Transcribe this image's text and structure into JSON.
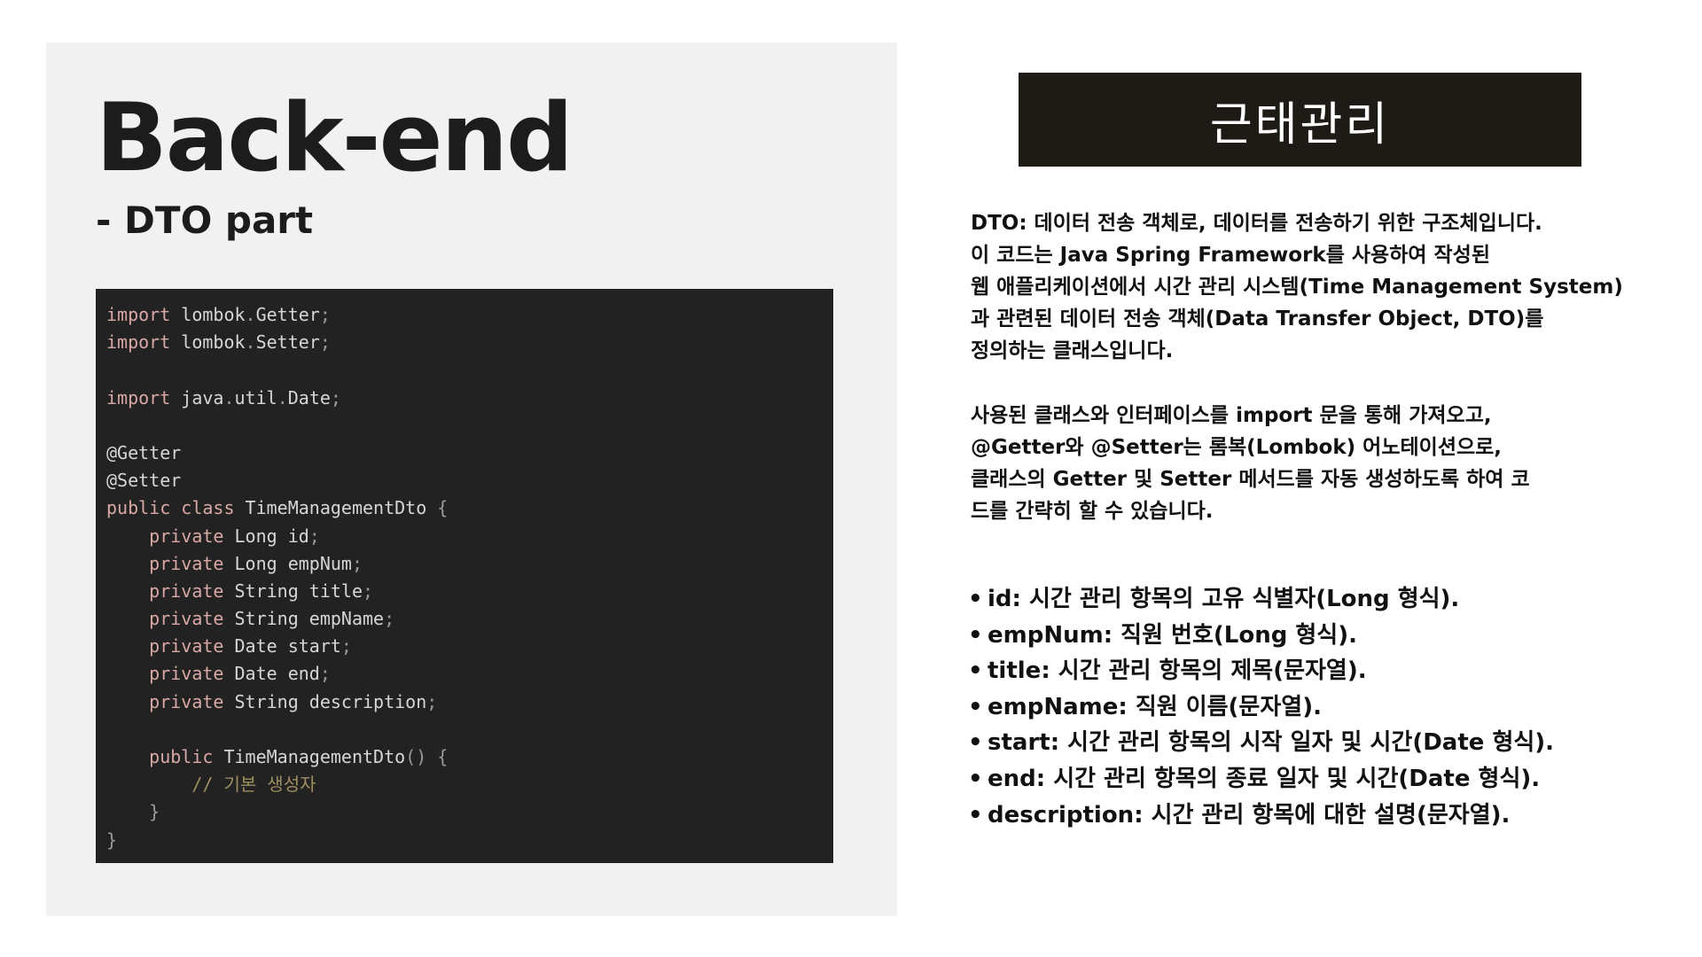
{
  "slide": {
    "title": "Back-end",
    "subtitle": "- DTO part",
    "header": "근태관리"
  },
  "code": {
    "lines": [
      [
        {
          "t": "kw",
          "v": "import"
        },
        {
          "t": "txt",
          "v": " lombok"
        },
        {
          "t": "punct",
          "v": "."
        },
        {
          "t": "txt",
          "v": "Getter"
        },
        {
          "t": "punct",
          "v": ";"
        }
      ],
      [
        {
          "t": "kw",
          "v": "import"
        },
        {
          "t": "txt",
          "v": " lombok"
        },
        {
          "t": "punct",
          "v": "."
        },
        {
          "t": "txt",
          "v": "Setter"
        },
        {
          "t": "punct",
          "v": ";"
        }
      ],
      [],
      [
        {
          "t": "kw",
          "v": "import"
        },
        {
          "t": "txt",
          "v": " java"
        },
        {
          "t": "punct",
          "v": "."
        },
        {
          "t": "txt",
          "v": "util"
        },
        {
          "t": "punct",
          "v": "."
        },
        {
          "t": "txt",
          "v": "Date"
        },
        {
          "t": "punct",
          "v": ";"
        }
      ],
      [],
      [
        {
          "t": "ann",
          "v": "@Getter"
        }
      ],
      [
        {
          "t": "ann",
          "v": "@Setter"
        }
      ],
      [
        {
          "t": "kw",
          "v": "public class"
        },
        {
          "t": "txt",
          "v": " TimeManagementDto "
        },
        {
          "t": "punct",
          "v": "{"
        }
      ],
      [
        {
          "t": "txt",
          "v": "    "
        },
        {
          "t": "kw",
          "v": "private"
        },
        {
          "t": "txt",
          "v": " Long id"
        },
        {
          "t": "punct",
          "v": ";"
        }
      ],
      [
        {
          "t": "txt",
          "v": "    "
        },
        {
          "t": "kw",
          "v": "private"
        },
        {
          "t": "txt",
          "v": " Long empNum"
        },
        {
          "t": "punct",
          "v": ";"
        }
      ],
      [
        {
          "t": "txt",
          "v": "    "
        },
        {
          "t": "kw",
          "v": "private"
        },
        {
          "t": "txt",
          "v": " String title"
        },
        {
          "t": "punct",
          "v": ";"
        }
      ],
      [
        {
          "t": "txt",
          "v": "    "
        },
        {
          "t": "kw",
          "v": "private"
        },
        {
          "t": "txt",
          "v": " String empName"
        },
        {
          "t": "punct",
          "v": ";"
        }
      ],
      [
        {
          "t": "txt",
          "v": "    "
        },
        {
          "t": "kw",
          "v": "private"
        },
        {
          "t": "txt",
          "v": " Date start"
        },
        {
          "t": "punct",
          "v": ";"
        }
      ],
      [
        {
          "t": "txt",
          "v": "    "
        },
        {
          "t": "kw",
          "v": "private"
        },
        {
          "t": "txt",
          "v": " Date end"
        },
        {
          "t": "punct",
          "v": ";"
        }
      ],
      [
        {
          "t": "txt",
          "v": "    "
        },
        {
          "t": "kw",
          "v": "private"
        },
        {
          "t": "txt",
          "v": " String description"
        },
        {
          "t": "punct",
          "v": ";"
        }
      ],
      [],
      [
        {
          "t": "txt",
          "v": "    "
        },
        {
          "t": "kw",
          "v": "public"
        },
        {
          "t": "txt",
          "v": " TimeManagementDto"
        },
        {
          "t": "punct",
          "v": "() {"
        }
      ],
      [
        {
          "t": "txt",
          "v": "        "
        },
        {
          "t": "cmt",
          "v": "// 기본 생성자"
        }
      ],
      [
        {
          "t": "txt",
          "v": "    "
        },
        {
          "t": "punct",
          "v": "}"
        }
      ],
      [
        {
          "t": "punct",
          "v": "}"
        }
      ]
    ]
  },
  "description": {
    "paragraph1": [
      "DTO: 데이터 전송 객체로, 데이터를 전송하기 위한 구조체입니다.",
      "이 코드는 Java Spring Framework를 사용하여 작성된",
      "웹 애플리케이션에서 시간 관리 시스템(Time Management System)",
      "과 관련된 데이터 전송 객체(Data Transfer Object, DTO)를",
      "정의하는 클래스입니다."
    ],
    "paragraph2": [
      "사용된 클래스와 인터페이스를 import 문을 통해 가져오고,",
      "@Getter와 @Setter는 롬복(Lombok) 어노테이션으로,",
      "클래스의 Getter 및 Setter 메서드를 자동 생성하도록 하여 코",
      "드를 간략히 할 수 있습니다."
    ]
  },
  "fields": {
    "bullet": "•",
    "items": [
      "id: 시간 관리 항목의 고유 식별자(Long 형식).",
      "empNum: 직원 번호(Long 형식).",
      "title: 시간 관리 항목의 제목(문자열).",
      "empName: 직원 이름(문자열).",
      "start: 시간 관리 항목의 시작 일자 및 시간(Date 형식).",
      "end: 시간 관리 항목의 종료 일자 및 시간(Date 형식).",
      "description: 시간 관리 항목에 대한 설명(문자열)."
    ]
  }
}
